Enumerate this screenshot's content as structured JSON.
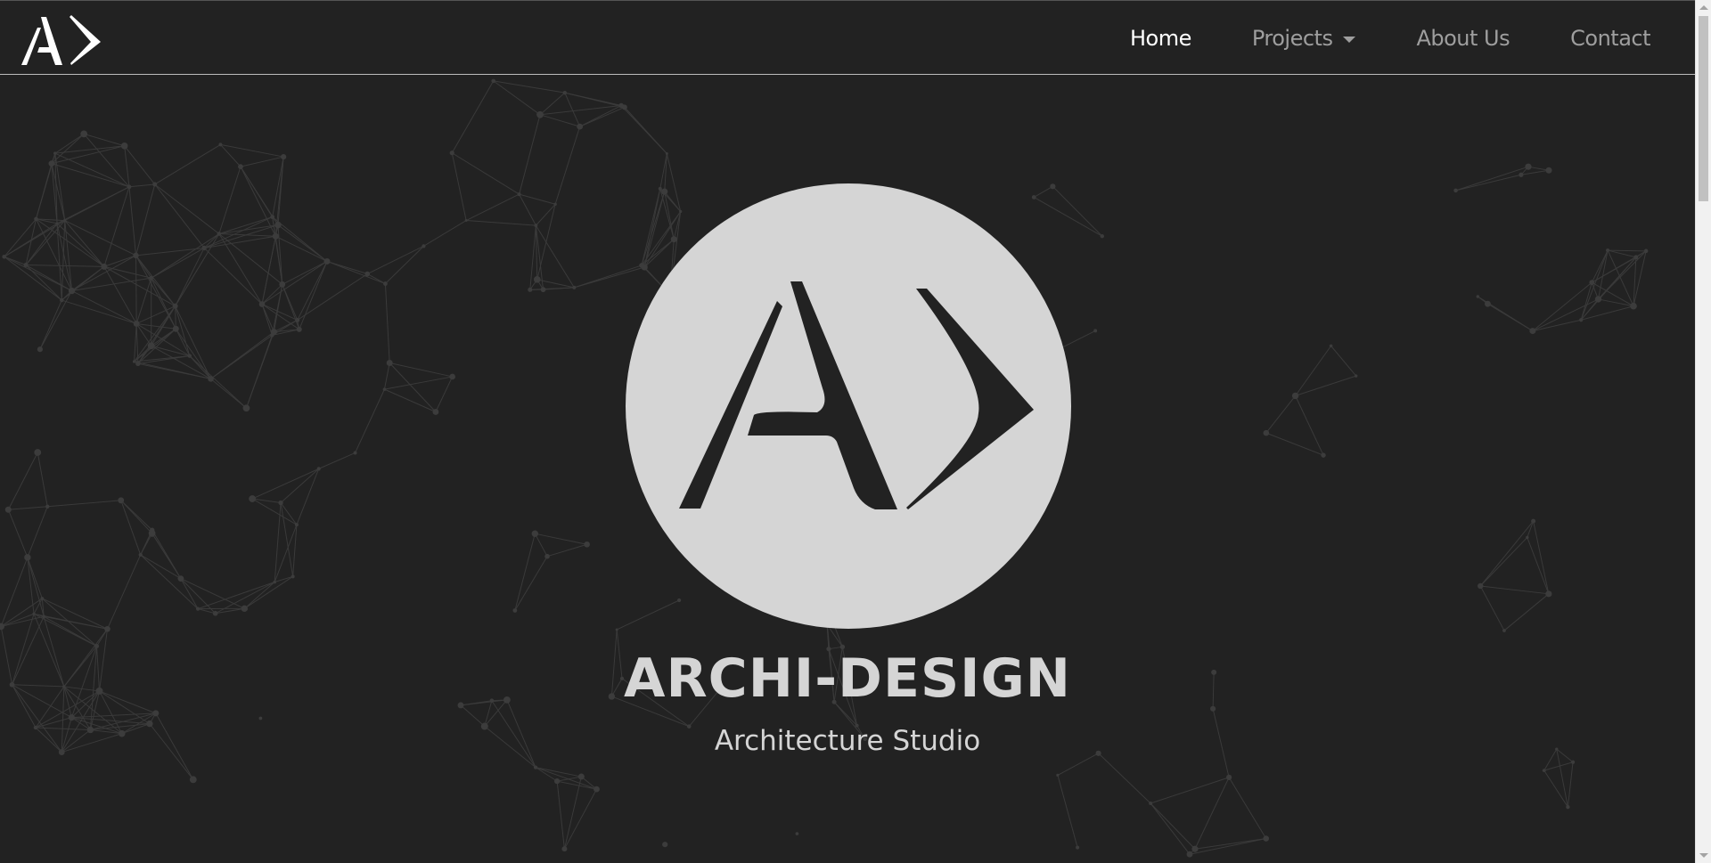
{
  "navbar": {
    "logo_icon": "ad-logo-icon",
    "items": [
      {
        "label": "Home",
        "active": true
      },
      {
        "label": "Projects",
        "dropdown": true
      },
      {
        "label": "About Us"
      },
      {
        "label": "Contact"
      }
    ]
  },
  "hero": {
    "logo_icon": "ad-circle-logo-icon",
    "title": "ARCHI-DESIGN",
    "subtitle": "Architecture Studio"
  },
  "colors": {
    "background": "#222222",
    "nav_active": "#ffffff",
    "nav_inactive": "#9e9e9e",
    "logo_circle": "#d5d5d5",
    "network_lines": "#3a3a3a"
  }
}
